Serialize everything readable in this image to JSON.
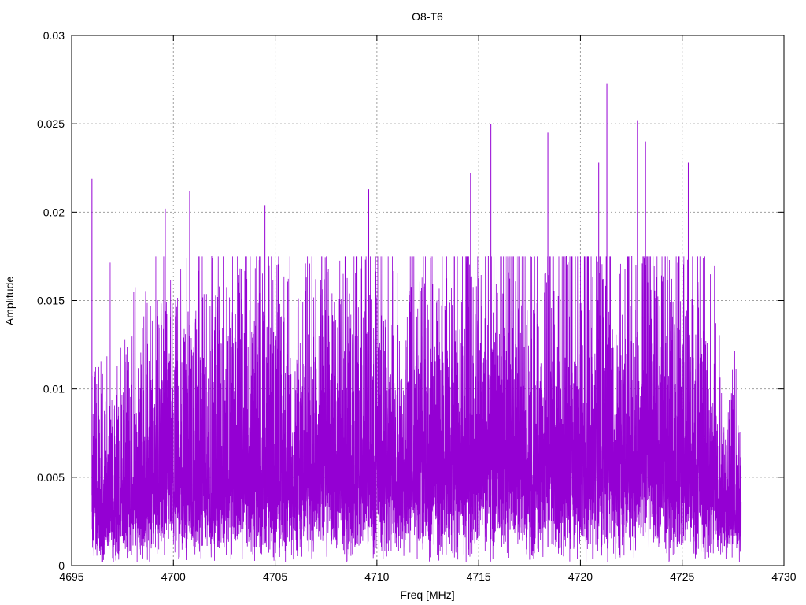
{
  "chart_data": {
    "type": "line",
    "title": "O8-T6",
    "xlabel": "Freq [MHz]",
    "ylabel": "Amplitude",
    "xlim": [
      4695,
      4730
    ],
    "ylim": [
      0,
      0.03
    ],
    "xticks": [
      "4695",
      "4700",
      "4705",
      "4710",
      "4715",
      "4720",
      "4725",
      "4730"
    ],
    "xtick_values": [
      4695,
      4700,
      4705,
      4710,
      4715,
      4720,
      4725,
      4730
    ],
    "yticks": [
      "0",
      "0.005",
      "0.01",
      "0.015",
      "0.02",
      "0.025",
      "0.03"
    ],
    "ytick_values": [
      0,
      0.005,
      0.01,
      0.015,
      0.02,
      0.025,
      0.03
    ],
    "grid": true,
    "series": [
      {
        "color": "#9400d3",
        "x_start": 4696.0,
        "x_end": 4727.9,
        "envelope_x": [
          4696.0,
          4697.0,
          4698.0,
          4699.0,
          4700.0,
          4702.0,
          4705.0,
          4708.0,
          4710.0,
          4713.0,
          4715.0,
          4717.0,
          4719.0,
          4720.0,
          4721.0,
          4722.0,
          4723.0,
          4724.0,
          4725.0,
          4726.0,
          4727.0,
          4727.9
        ],
        "envelope_mean": [
          0.004,
          0.005,
          0.006,
          0.0065,
          0.007,
          0.0075,
          0.0078,
          0.0078,
          0.0079,
          0.008,
          0.0082,
          0.0085,
          0.0088,
          0.009,
          0.009,
          0.0088,
          0.0087,
          0.0085,
          0.008,
          0.0075,
          0.006,
          0.004
        ],
        "peaks": [
          {
            "x": 4696.0,
            "y": 0.0219
          },
          {
            "x": 4699.6,
            "y": 0.0202
          },
          {
            "x": 4700.8,
            "y": 0.0212
          },
          {
            "x": 4704.5,
            "y": 0.0204
          },
          {
            "x": 4709.6,
            "y": 0.0213
          },
          {
            "x": 4714.6,
            "y": 0.0222
          },
          {
            "x": 4715.6,
            "y": 0.025
          },
          {
            "x": 4718.4,
            "y": 0.0245
          },
          {
            "x": 4720.9,
            "y": 0.0228
          },
          {
            "x": 4721.3,
            "y": 0.0273
          },
          {
            "x": 4722.8,
            "y": 0.0252
          },
          {
            "x": 4723.2,
            "y": 0.024
          },
          {
            "x": 4725.3,
            "y": 0.0228
          }
        ]
      }
    ]
  }
}
